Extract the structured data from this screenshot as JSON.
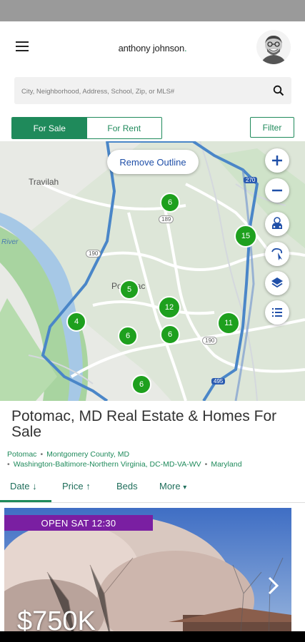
{
  "header": {
    "logo_text": "anthony johnson",
    "logo_dot": "."
  },
  "search": {
    "placeholder": "City, Neighborhood, Address, School, Zip, or MLS#"
  },
  "mode_tabs": [
    {
      "label": "For Sale",
      "active": true
    },
    {
      "label": "For Rent",
      "active": false
    }
  ],
  "filter_label": "Filter",
  "map": {
    "remove_outline_label": "Remove Outline",
    "place_labels": [
      "Travilah",
      "Potomac",
      "River"
    ],
    "road_shields": [
      "190",
      "189",
      "190",
      "495",
      "270"
    ],
    "clusters": [
      "6",
      "15",
      "5",
      "12",
      "4",
      "6",
      "6",
      "11",
      "6"
    ],
    "controls": [
      "zoom-in",
      "zoom-out",
      "commute",
      "draw",
      "layers",
      "list"
    ]
  },
  "page_title": "Potomac, MD Real Estate & Homes For Sale",
  "breadcrumbs": [
    "Potomac",
    "Montgomery County, MD",
    "Washington-Baltimore-Northern Virginia, DC-MD-VA-WV",
    "Maryland"
  ],
  "sort": {
    "items": [
      {
        "label": "Date",
        "arrow": "↓",
        "active": true
      },
      {
        "label": "Price",
        "arrow": "↑",
        "active": false
      },
      {
        "label": "Beds",
        "arrow": "",
        "active": false
      },
      {
        "label": "More",
        "arrow": "▾",
        "active": false
      }
    ]
  },
  "listing": {
    "open_house": "OPEN SAT 12:30",
    "price": "$750K"
  },
  "colors": {
    "brand": "#1f8a5b",
    "cluster": "#1ea01e",
    "badge": "#7a1fa2",
    "outline": "#4a86c8"
  }
}
